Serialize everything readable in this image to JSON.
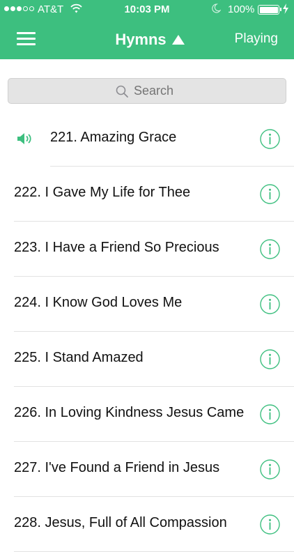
{
  "status_bar": {
    "carrier": "AT&T",
    "time": "10:03 PM",
    "battery": "100%"
  },
  "nav": {
    "title": "Hymns",
    "playing": "Playing"
  },
  "search": {
    "placeholder": "Search"
  },
  "colors": {
    "accent": "#3dbf7f"
  },
  "hymns": [
    {
      "title": "221. Amazing Grace",
      "playing": true
    },
    {
      "title": "222. I Gave My Life for Thee"
    },
    {
      "title": "223. I Have a Friend So Precious"
    },
    {
      "title": "224. I Know God Loves Me"
    },
    {
      "title": "225. I Stand Amazed"
    },
    {
      "title": "226. In Loving Kindness Jesus Came"
    },
    {
      "title": "227. I've Found a Friend in Jesus"
    },
    {
      "title": "228. Jesus, Full of All Compassion"
    }
  ]
}
